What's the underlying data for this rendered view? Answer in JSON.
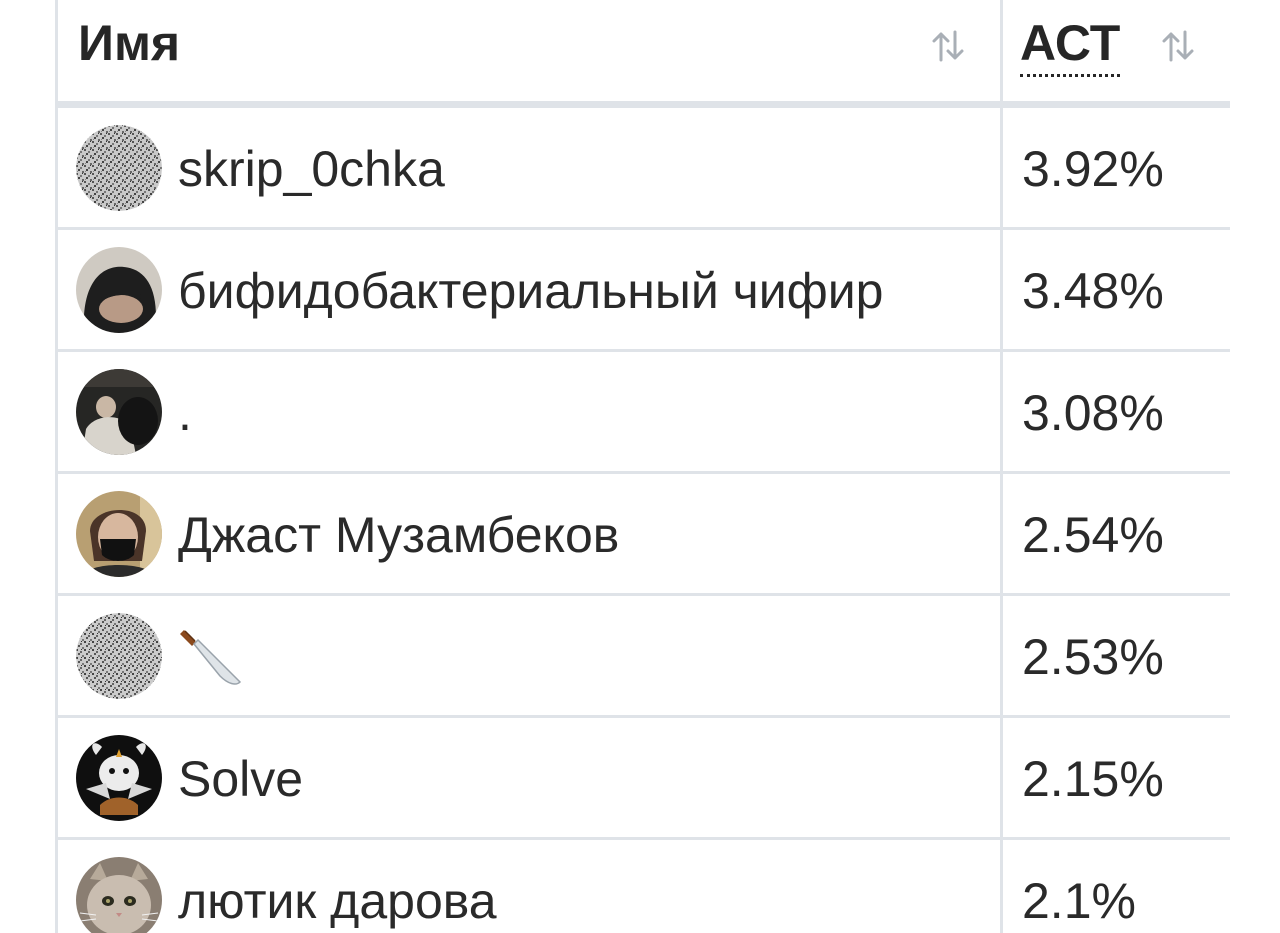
{
  "header": {
    "name_label": "Имя",
    "act_label": "АСТ",
    "sort_icon": "sort-arrows-icon"
  },
  "rows": [
    {
      "name": "skrip_0chka",
      "value": "3.92%",
      "avatar": "noise-pattern-avatar"
    },
    {
      "name": "бифидобактериальный чифир",
      "value": "3.48%",
      "avatar": "person-photo-avatar"
    },
    {
      "name": ".",
      "value": "3.08%",
      "avatar": "dark-photo-avatar"
    },
    {
      "name": "Джаст Музамбеков",
      "value": "2.54%",
      "avatar": "masked-person-avatar"
    },
    {
      "name": "",
      "value": "2.53%",
      "avatar": "noise-pattern-avatar",
      "name_icon": "knife-emoji-icon"
    },
    {
      "name": "Solve",
      "value": "2.15%",
      "avatar": "goat-illustration-avatar"
    },
    {
      "name": "лютик дарова",
      "value": "2.1%",
      "avatar": "cat-photo-avatar"
    }
  ],
  "colors": {
    "grid": "#dfe3e8",
    "text": "#2a2a2a",
    "icon": "#a9afb6"
  }
}
